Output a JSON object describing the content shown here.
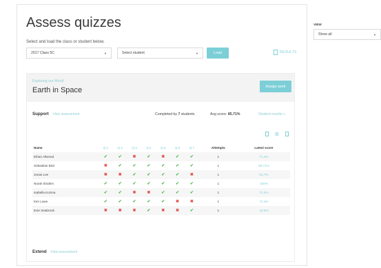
{
  "page_title": "Assess quizzes",
  "subtitle": "Select and load the class or student below.",
  "class_select": {
    "value": "2017 Class 5C"
  },
  "student_select": {
    "value": "Select student"
  },
  "load_label": "Load",
  "results_label": "RESULTS",
  "unit": {
    "subtitle": "Exploring our World",
    "title": "Earth in Space"
  },
  "assign_label": "Assign work",
  "support": {
    "label": "Support",
    "link": "View assessment"
  },
  "completed": {
    "prefix": "Completed by",
    "count": "7",
    "suffix": "students"
  },
  "avg": {
    "label": "Avg score:",
    "value": "85.71%"
  },
  "student_results_label": "Student results >",
  "extend": {
    "label": "Extend",
    "link": "View assessment"
  },
  "view": {
    "label": "VIEW",
    "value": "Show all"
  },
  "table": {
    "headers": {
      "name": "Name",
      "attempts": "Attempts",
      "latest": "Latest score"
    },
    "questions": [
      "Q.1",
      "Q.2",
      "Q.3",
      "Q.4",
      "Q.5",
      "Q.6",
      "Q.7"
    ],
    "rows": [
      {
        "name": "Ethan Allwood",
        "marks": [
          1,
          1,
          0,
          1,
          0,
          1,
          1
        ],
        "attempts": "1",
        "score": "71.4%"
      },
      {
        "name": "Sebastian Bird",
        "marks": [
          0,
          1,
          1,
          1,
          1,
          1,
          1
        ],
        "attempts": "1",
        "score": "85.71%"
      },
      {
        "name": "Jonas Lee",
        "marks": [
          0,
          0,
          1,
          1,
          1,
          1,
          0
        ],
        "attempts": "1",
        "score": "81.7%"
      },
      {
        "name": "Norah Ibrahim",
        "marks": [
          1,
          1,
          1,
          1,
          1,
          1,
          1
        ],
        "attempts": "1",
        "score": "100%"
      },
      {
        "name": "Isabella Kozma",
        "marks": [
          1,
          1,
          0,
          0,
          1,
          1,
          1
        ],
        "attempts": "1",
        "score": "71.4%"
      },
      {
        "name": "Kim Lowe",
        "marks": [
          1,
          1,
          1,
          1,
          1,
          0,
          0
        ],
        "attempts": "1",
        "score": "71.4%"
      },
      {
        "name": "Evie Seabrook",
        "marks": [
          0,
          0,
          0,
          1,
          0,
          0,
          1
        ],
        "attempts": "1",
        "score": "42.9%"
      }
    ]
  },
  "colors": {
    "accent": "#7ccfd7",
    "tick": "#4cb84c",
    "cross": "#e04b4b"
  }
}
